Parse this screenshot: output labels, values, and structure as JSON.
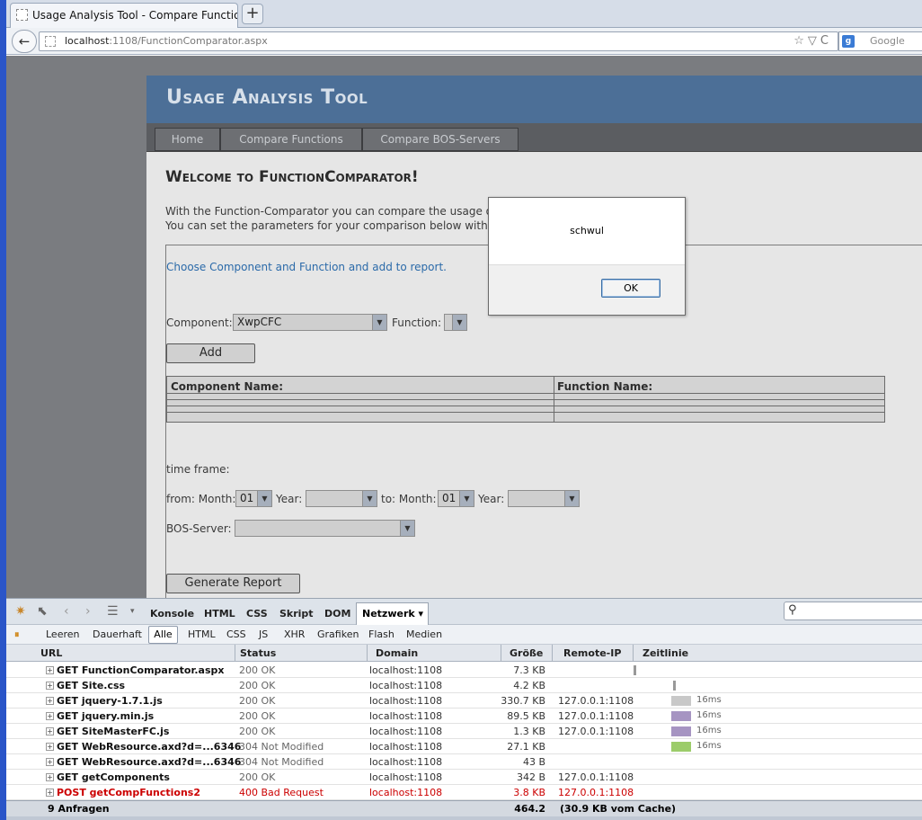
{
  "browser": {
    "tab_title": "Usage Analysis Tool - Compare Functions",
    "new_tab": "+",
    "back": "←",
    "url_host": "localhost",
    "url_path": ":1108/FunctionComparator.aspx",
    "url_icons": "☆▽C",
    "search_engine_icon": "g",
    "search_placeholder": "Google"
  },
  "app": {
    "title": "Usage Analysis Tool",
    "menu": [
      "Home",
      "Compare Functions",
      "Compare BOS-Servers"
    ],
    "welcome": "Welcome to FunctionComparator!",
    "intro_line1": "With the Function-Comparator you can compare the usage of d",
    "intro_line2": "You can set the parameters for your comparison below with the",
    "choose_link": "Choose Component and Function and add to report.",
    "component_label": "Component:",
    "component_value": "XwpCFC",
    "function_label": "Function:",
    "function_value": "",
    "add_button": "Add",
    "grid_col1": "Component Name:",
    "grid_col2": "Function Name:",
    "timeframe_label": "time frame:",
    "from_label": "from: Month:",
    "from_month": "01",
    "year_label": "Year:",
    "from_year": "",
    "to_label": "to: Month:",
    "to_month": "01",
    "to_year": "",
    "bos_label": "BOS-Server:",
    "bos_value": "",
    "generate_button": "Generate Report"
  },
  "dialog": {
    "message": "schwul",
    "ok": "OK"
  },
  "firebug": {
    "tabs": [
      "Konsole",
      "HTML",
      "CSS",
      "Skript",
      "DOM"
    ],
    "active_tab": "Netzwerk ▾",
    "filters": [
      "Leeren",
      "Dauerhaft",
      "Alle",
      "HTML",
      "CSS",
      "JS",
      "XHR",
      "Grafiken",
      "Flash",
      "Medien"
    ],
    "columns": [
      "URL",
      "Status",
      "Domain",
      "Größe",
      "Remote-IP",
      "Zeitlinie"
    ],
    "rows": [
      {
        "url": "GET FunctionComparator.aspx",
        "status": "200 OK",
        "domain": "localhost:1108",
        "size": "7.3 KB",
        "ip": "",
        "time": "",
        "bar": "#999999",
        "error": false
      },
      {
        "url": "GET Site.css",
        "status": "200 OK",
        "domain": "localhost:1108",
        "size": "4.2 KB",
        "ip": "",
        "time": "",
        "bar": "#999999",
        "error": false
      },
      {
        "url": "GET jquery-1.7.1.js",
        "status": "200 OK",
        "domain": "localhost:1108",
        "size": "330.7 KB",
        "ip": "127.0.0.1:1108",
        "time": "16ms",
        "bar": "#c8c8c8",
        "error": false
      },
      {
        "url": "GET jquery.min.js",
        "status": "200 OK",
        "domain": "localhost:1108",
        "size": "89.5 KB",
        "ip": "127.0.0.1:1108",
        "time": "16ms",
        "bar": "#a694c2",
        "error": false
      },
      {
        "url": "GET SiteMasterFC.js",
        "status": "200 OK",
        "domain": "localhost:1108",
        "size": "1.3 KB",
        "ip": "127.0.0.1:1108",
        "time": "16ms",
        "bar": "#a694c2",
        "error": false
      },
      {
        "url": "GET WebResource.axd?d=...6346",
        "status": "304 Not Modified",
        "domain": "localhost:1108",
        "size": "27.1 KB",
        "ip": "",
        "time": "16ms",
        "bar": "#9ccc6a",
        "error": false
      },
      {
        "url": "GET WebResource.axd?d=...6346",
        "status": "304 Not Modified",
        "domain": "localhost:1108",
        "size": "43 B",
        "ip": "",
        "time": "",
        "bar": "",
        "error": false
      },
      {
        "url": "GET getComponents",
        "status": "200 OK",
        "domain": "localhost:1108",
        "size": "342 B",
        "ip": "127.0.0.1:1108",
        "time": "",
        "bar": "",
        "error": false
      },
      {
        "url": "POST getCompFunctions2",
        "status": "400 Bad Request",
        "domain": "localhost:1108",
        "size": "3.8 KB",
        "ip": "127.0.0.1:1108",
        "time": "",
        "bar": "",
        "error": true
      }
    ],
    "footer_count": "9 Anfragen",
    "footer_size": "464.2 KB",
    "footer_cache": "(30.9 KB vom Cache)"
  }
}
